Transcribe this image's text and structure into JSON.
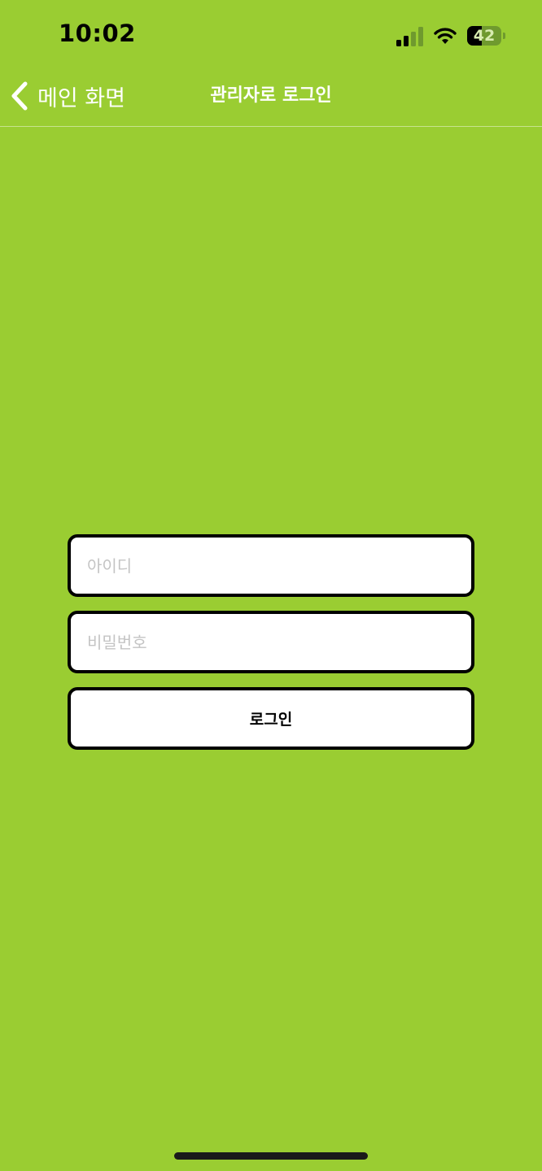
{
  "status_bar": {
    "time": "10:02",
    "battery_level": "42",
    "battery_fraction": 0.42,
    "signal_bars_active": 2,
    "signal_bars_total": 4
  },
  "nav": {
    "back_label": "메인 화면",
    "back_icon": "chevron-left-icon",
    "title": "관리자로 로그인"
  },
  "login_form": {
    "id_placeholder": "아이디",
    "id_value": "",
    "password_placeholder": "비밀번호",
    "password_value": "",
    "submit_label": "로그인"
  },
  "colors": {
    "background": "#9acd32",
    "nav_text": "#ffffff",
    "field_border": "#000000",
    "placeholder": "#c4c4c4"
  }
}
